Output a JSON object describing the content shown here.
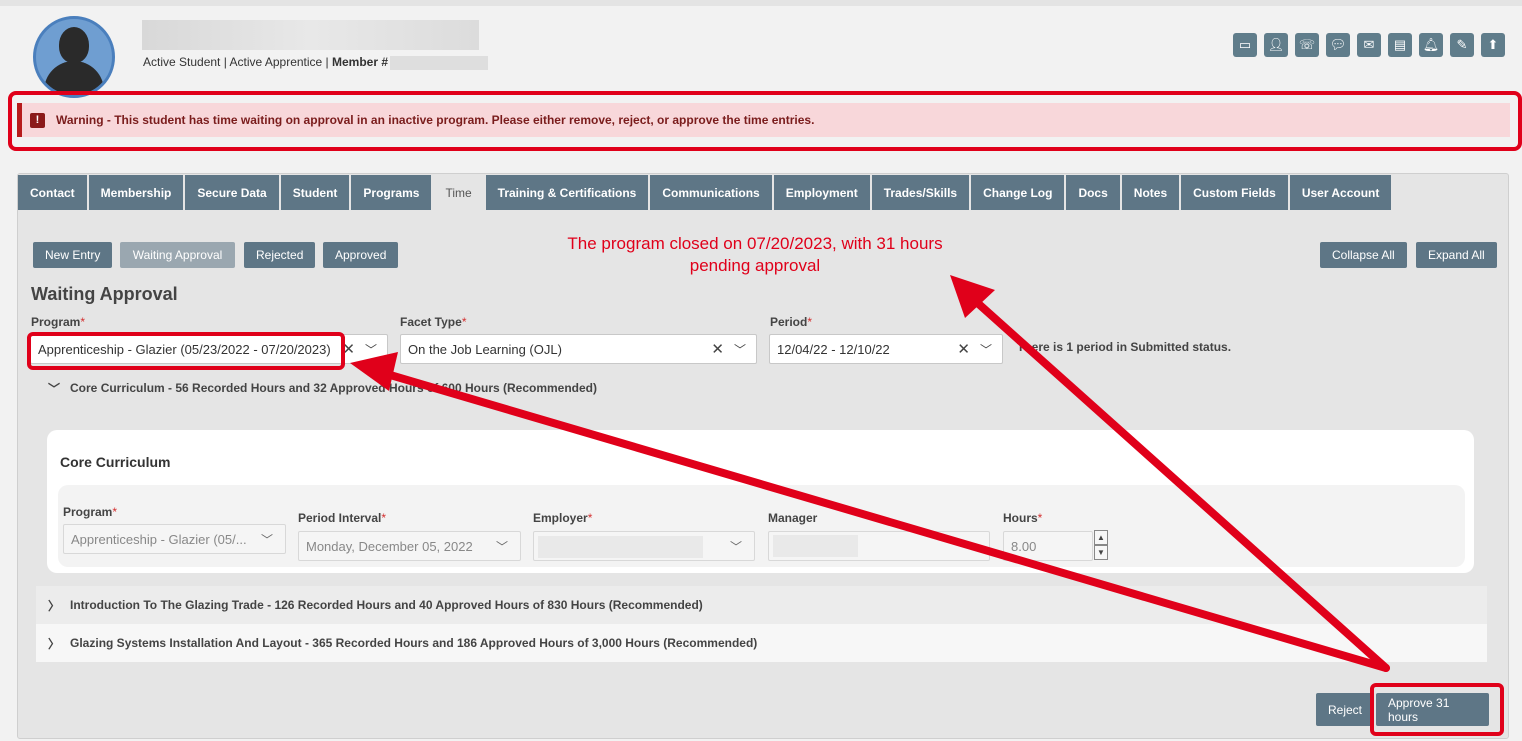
{
  "header": {
    "status_prefix": "Active Student | Active Apprentice | ",
    "member_label": "Member #",
    "icons": [
      "id-card-icon",
      "person-icon",
      "phone-icon",
      "chat-icon",
      "envelope-icon",
      "document-icon",
      "bell-icon",
      "edit-document-icon",
      "upload-icon"
    ]
  },
  "warning": {
    "text": "Warning - This student has time waiting on approval in an inactive program. Please either remove, reject, or approve the time entries."
  },
  "tabs": [
    "Contact",
    "Membership",
    "Secure Data",
    "Student",
    "Programs",
    "Time",
    "Training & Certifications",
    "Communications",
    "Employment",
    "Trades/Skills",
    "Change Log",
    "Docs",
    "Notes",
    "Custom Fields",
    "User Account"
  ],
  "active_tab": "Time",
  "actions": {
    "new_entry": "New Entry",
    "waiting_approval": "Waiting Approval",
    "rejected": "Rejected",
    "approved": "Approved",
    "collapse_all": "Collapse All",
    "expand_all": "Expand All"
  },
  "annotation": {
    "line1": "The program closed on 07/20/2023, with 31 hours",
    "line2": "pending approval"
  },
  "section_title": "Waiting Approval",
  "filters": {
    "program_label": "Program",
    "program_value": "Apprenticeship - Glazier (05/23/2022 - 07/20/2023)",
    "facet_label": "Facet Type",
    "facet_value": "On the Job Learning (OJL)",
    "period_label": "Period",
    "period_value": "12/04/22 - 12/10/22",
    "required_mark": "*",
    "status_text": "There is 1 period in Submitted status."
  },
  "groups": [
    "Core Curriculum - 56 Recorded Hours and 32 Approved Hours of 600 Hours (Recommended)",
    "Introduction To The Glazing Trade - 126 Recorded Hours and 40 Approved Hours of 830 Hours (Recommended)",
    "Glazing Systems Installation And Layout - 365 Recorded Hours and 186 Approved Hours of 3,000 Hours (Recommended)"
  ],
  "entry": {
    "card_title": "Core Curriculum",
    "program_label": "Program",
    "program_value": "Apprenticeship - Glazier (05/...",
    "period_label": "Period Interval",
    "period_value": "Monday, December 05, 2022",
    "employer_label": "Employer",
    "manager_label": "Manager",
    "hours_label": "Hours",
    "hours_value": "8.00"
  },
  "footer": {
    "reject": "Reject",
    "approve": "Approve 31 hours"
  },
  "colors": {
    "accent": "#5e7686",
    "annotation_red": "#e0001a",
    "warning_bg": "#f8d7da"
  }
}
